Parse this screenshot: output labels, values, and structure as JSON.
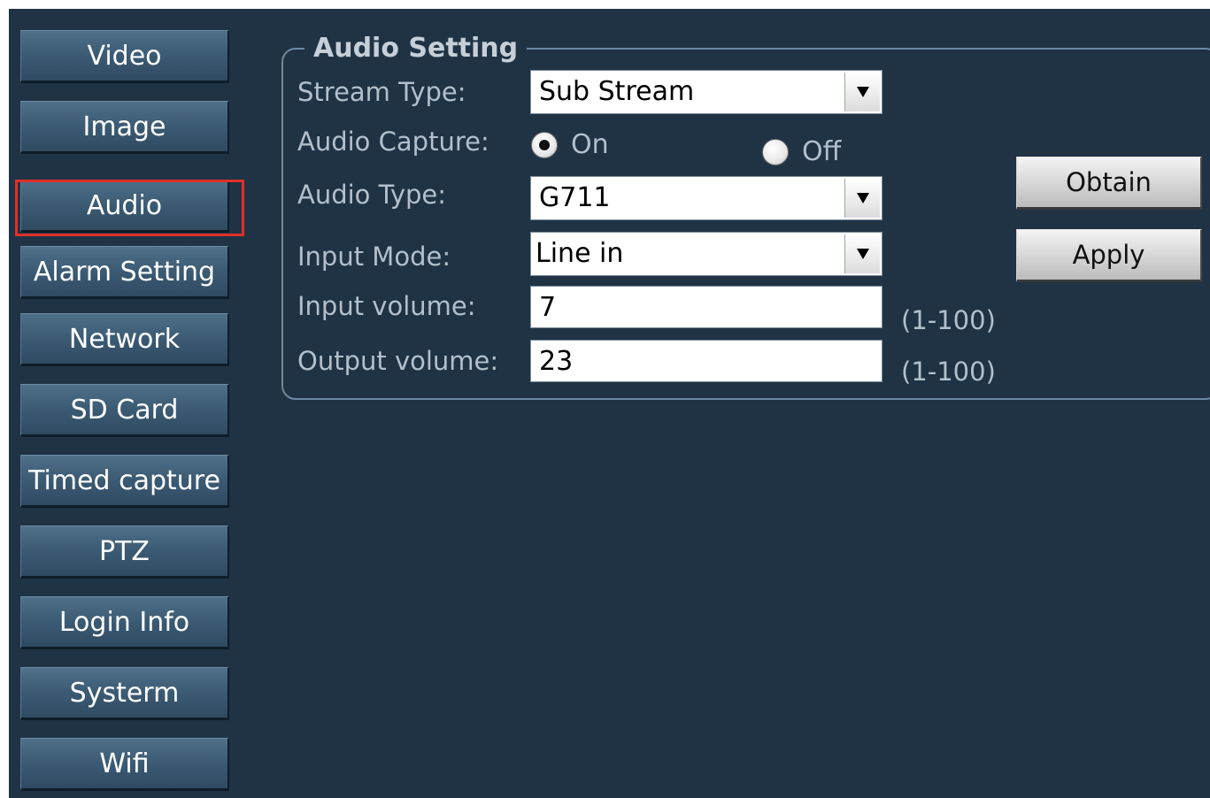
{
  "sidebar": {
    "items": [
      {
        "label": "Video"
      },
      {
        "label": "Image"
      },
      {
        "label": "Audio"
      },
      {
        "label": "Alarm Setting"
      },
      {
        "label": "Network"
      },
      {
        "label": "SD Card"
      },
      {
        "label": "Timed capture"
      },
      {
        "label": "PTZ"
      },
      {
        "label": "Login Info"
      },
      {
        "label": "Systerm"
      },
      {
        "label": "Wifi"
      }
    ],
    "selected": "Audio",
    "highlight_color": "#e0302a"
  },
  "audio_setting": {
    "title": "Audio Setting",
    "stream_type": {
      "label": "Stream Type:",
      "value": "Sub Stream"
    },
    "audio_capture": {
      "label": "Audio Capture:",
      "options": [
        {
          "label": "On",
          "checked": true
        },
        {
          "label": "Off",
          "checked": false
        }
      ]
    },
    "audio_type": {
      "label": "Audio Type:",
      "value": "G711"
    },
    "input_mode": {
      "label": "Input Mode:",
      "value": "Line in"
    },
    "input_volume": {
      "label": "Input volume:",
      "value": "7",
      "range": "(1-100)"
    },
    "output_volume": {
      "label": "Output volume:",
      "value": "23",
      "range": "(1-100)"
    }
  },
  "actions": {
    "obtain": "Obtain",
    "apply": "Apply"
  },
  "icons": {
    "select_arrow": "triangle-down-icon"
  }
}
